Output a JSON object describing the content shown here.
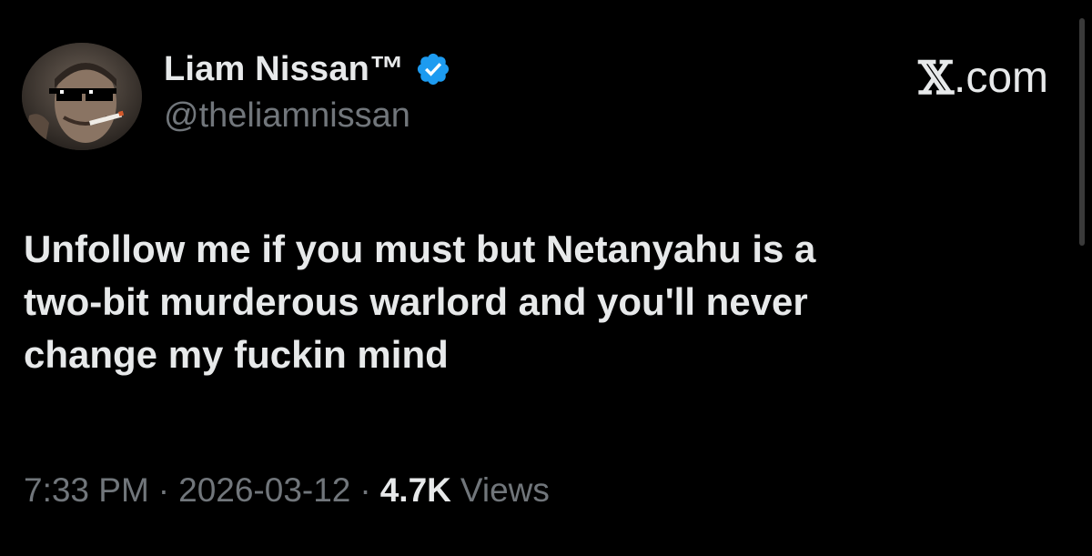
{
  "tweet": {
    "author": {
      "display_name": "Liam Nissan™",
      "handle": "@theliamnissan",
      "verified": true,
      "avatar_icon": "profile-photo-sunglasses-cigarette"
    },
    "brand": {
      "x_glyph": "𝕏",
      "suffix": ".com"
    },
    "text_lines": [
      "Unfollow me if you must but Netanyahu is a",
      "two-bit murderous warlord and you'll never",
      "change my fuckin mind"
    ],
    "meta": {
      "time": "7:33 PM",
      "separator": "·",
      "date": "2026-03-12",
      "views_count": "4.7K",
      "views_label": "Views"
    }
  },
  "colors": {
    "background": "#000000",
    "text_primary": "#e7e9ea",
    "text_secondary": "#71767b",
    "verified_blue": "#1d9bf0"
  }
}
